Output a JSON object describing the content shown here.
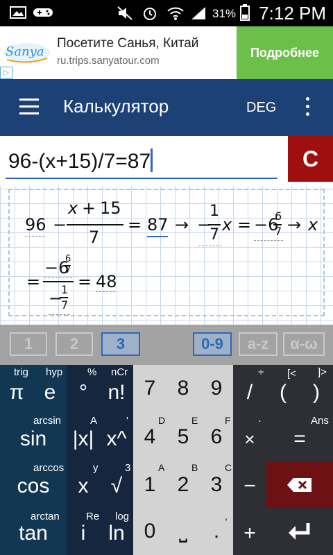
{
  "status": {
    "time": "7:12 PM",
    "battery": "31%"
  },
  "ad": {
    "title": "Посетите Санья, Китай",
    "url": "ru.trips.sanyatour.com",
    "cta": "Подробнее",
    "logo_text": "Sanya"
  },
  "appbar": {
    "title": "Калькулятор",
    "mode": "DEG"
  },
  "input": {
    "expression": "96-(x+15)/7=87",
    "clear_label": "C"
  },
  "work": {
    "line1": {
      "a": "96",
      "minus": "−",
      "num_x": "x",
      "num_plus": "+",
      "num_15": "15",
      "den": "7",
      "eq": "=",
      "rhs": "87",
      "arrow1": "→",
      "neg": "−",
      "c_num": "1",
      "c_den": "7",
      "var": "x",
      "eq2": "=",
      "neg2": "−6",
      "m_num": "6",
      "m_den": "7",
      "arrow2": "→",
      "var2": "x"
    },
    "line2": {
      "eq": "=",
      "top": "−6",
      "top_num": "6",
      "top_den": "7",
      "bot_neg": "−",
      "bot_num": "1",
      "bot_den": "7",
      "eq2": "=",
      "result": "48"
    }
  },
  "steps": [
    {
      "label": "1",
      "active": false
    },
    {
      "label": "2",
      "active": false
    },
    {
      "label": "3",
      "active": true
    },
    {
      "label": "0-9",
      "active": true
    },
    {
      "label": "a-z",
      "active": false
    },
    {
      "label": "α-ω",
      "active": false
    }
  ],
  "keys": {
    "row1": {
      "pi": "π",
      "e": "e",
      "deg": "°",
      "ncr": "n!",
      "seven": "7",
      "eight": "8",
      "nine": "9",
      "div": "/",
      "paren": "(",
      "rparen": ")",
      "sub_trig": "trig",
      "sub_hyp": "hyp",
      "sub_pct": "%",
      "sub_ncr": "nCr",
      "sub_div": "÷",
      "sub_lb": "[<",
      "sub_rb": "]>"
    },
    "row2": {
      "sin": "sin",
      "abs": "|x|",
      "pow": "x^",
      "four": "4",
      "five": "5",
      "six": "6",
      "mul": "×",
      "eq": "=",
      "sub_arcsin": "arcsin",
      "sub_A": "A",
      "sub_prime": "'",
      "sub_D": "D",
      "sub_E": "E",
      "sub_F": "F",
      "sub_dot": "·",
      "sub_ans": "Ans"
    },
    "row3": {
      "cos": "cos",
      "x": "x",
      "sqrt": "√",
      "one": "1",
      "two": "2",
      "three": "3",
      "minus": "−",
      "sub_arccos": "arccos",
      "sub_y": "y",
      "sub_3": "3",
      "sub_A": "A",
      "sub_B": "B",
      "sub_C": "C"
    },
    "row4": {
      "tan": "tan",
      "i": "i",
      "ln": "ln",
      "zero": "0",
      "space": "⎵",
      "dot": ".",
      "plus": "+",
      "sub_arctan": "arctan",
      "sub_re": "Re",
      "sub_log": "log",
      "sub_comma": ","
    }
  }
}
